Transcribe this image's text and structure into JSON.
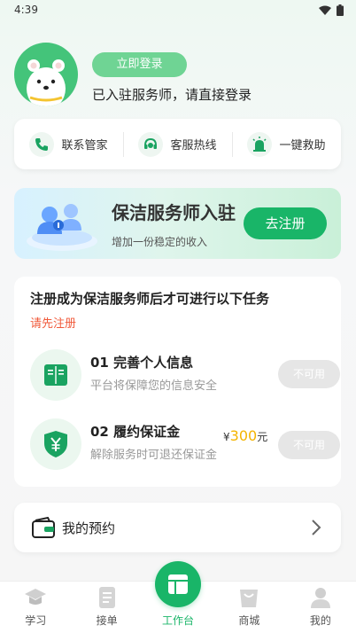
{
  "status_bar": {
    "time": "4:39"
  },
  "profile": {
    "login_button": "立即登录",
    "login_hint": "已入驻服务师，请直接登录"
  },
  "quick_actions": [
    {
      "label": "联系管家",
      "icon": "phone-icon"
    },
    {
      "label": "客服热线",
      "icon": "headset-icon"
    },
    {
      "label": "一键救助",
      "icon": "alarm-icon"
    }
  ],
  "banner": {
    "title": "保洁服务师入驻",
    "subtitle": "增加一份稳定的收入",
    "button": "去注册"
  },
  "tasks": {
    "heading": "注册成为保洁服务师后才可进行以下任务",
    "warning": "请先注册",
    "items": [
      {
        "title": "01 完善个人信息",
        "desc": "平台将保障您的信息安全",
        "button": "不可用",
        "icon": "book-icon"
      },
      {
        "title": "02 履约保证金",
        "desc": "解除服务时可退还保证金",
        "button": "不可用",
        "icon": "shield-yen-icon",
        "price_symbol": "¥",
        "price_amount": "300",
        "price_unit": "元"
      }
    ]
  },
  "booking": {
    "label": "我的预约"
  },
  "tabbar": {
    "items": [
      {
        "label": "学习",
        "icon": "graduation-cap-icon"
      },
      {
        "label": "接单",
        "icon": "document-icon"
      },
      {
        "label": "工作台",
        "icon": "dashboard-icon",
        "active": true
      },
      {
        "label": "商城",
        "icon": "shopping-bag-icon"
      },
      {
        "label": "我的",
        "icon": "person-icon"
      }
    ]
  },
  "colors": {
    "accent": "#19b568",
    "warning": "#f05a3b",
    "price": "#f4b400"
  }
}
